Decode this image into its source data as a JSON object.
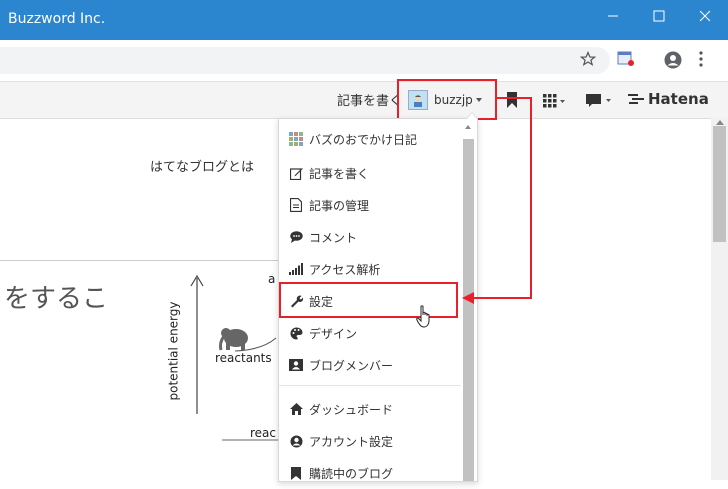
{
  "window": {
    "title": "Buzzword Inc."
  },
  "header": {
    "write_label": "記事を書く",
    "username": "buzzjp",
    "logo_text": "Hatena"
  },
  "page": {
    "intro_text": "はてなブログとは",
    "big_text": "をするこ",
    "diagram": {
      "y_label": "potential energy",
      "reactants": "reactants",
      "top_label_fragment": "a",
      "bottom_label_fragment": "reac"
    }
  },
  "menu": {
    "items": [
      {
        "label": "バズのおでかけ日記",
        "icon": "blog-icon"
      },
      {
        "label": "記事を書く",
        "icon": "edit-icon"
      },
      {
        "label": "記事の管理",
        "icon": "document-icon"
      },
      {
        "label": "コメント",
        "icon": "comment-icon"
      },
      {
        "label": "アクセス解析",
        "icon": "signal-icon"
      },
      {
        "label": "設定",
        "icon": "wrench-icon"
      },
      {
        "label": "デザイン",
        "icon": "palette-icon"
      },
      {
        "label": "ブログメンバー",
        "icon": "member-card-icon"
      },
      {
        "label": "ダッシュボード",
        "icon": "home-icon"
      },
      {
        "label": "アカウント設定",
        "icon": "user-circle-icon"
      },
      {
        "label": "購読中のブログ",
        "icon": "bookmark-icon"
      }
    ]
  },
  "colors": {
    "titlebar": "#2b86cf",
    "highlight": "#e8202a"
  }
}
